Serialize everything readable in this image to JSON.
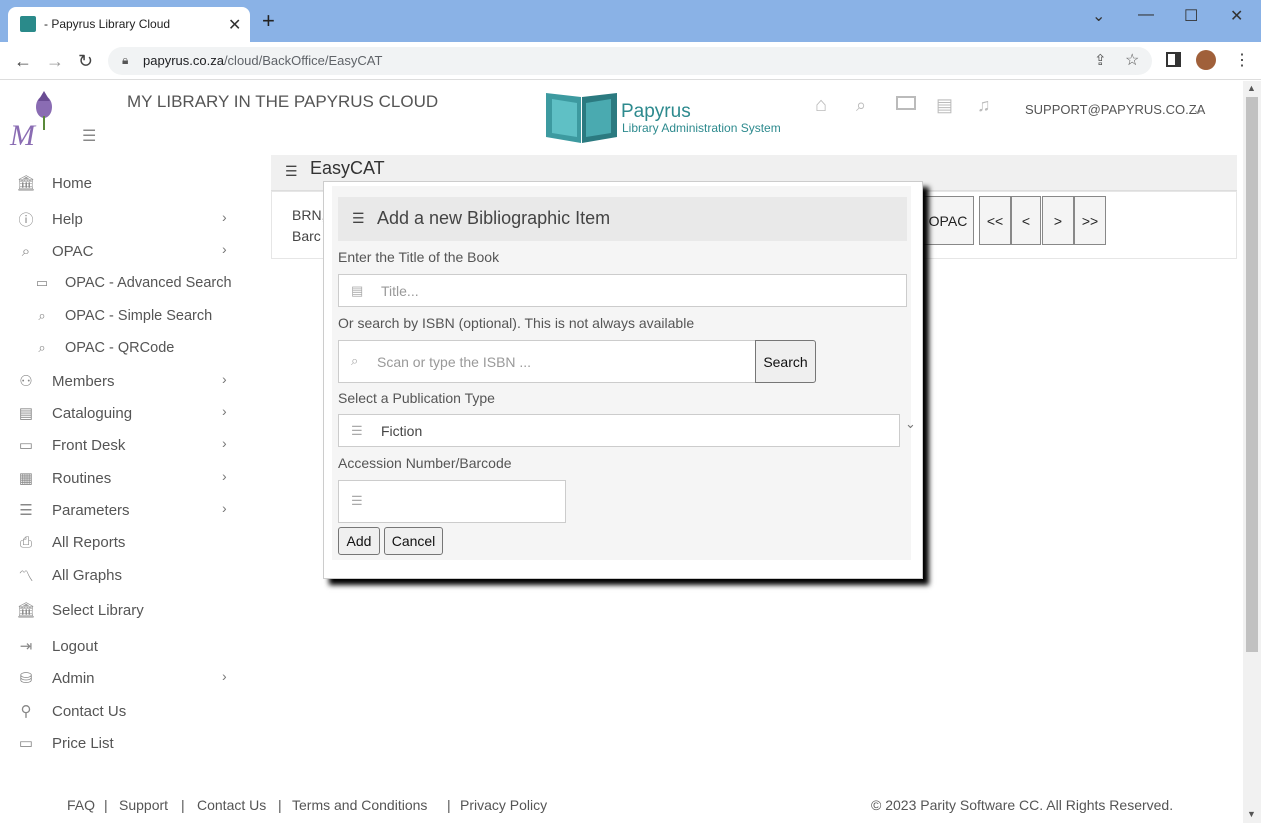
{
  "browser": {
    "tab_title": "- Papyrus Library Cloud",
    "url_host": "papyrus.co.za",
    "url_path": "/cloud/BackOffice/EasyCAT"
  },
  "header": {
    "site_title": "MY LIBRARY IN THE PAPYRUS CLOUD",
    "brand_name": "Papyrus",
    "brand_sub": "Library Administration System",
    "user": "SUPPORT@PAPYRUS.CO.ZA"
  },
  "sidebar": {
    "items": [
      {
        "label": "Home",
        "icon": "bank-icon"
      },
      {
        "label": "Help",
        "icon": "info-icon"
      },
      {
        "label": "OPAC",
        "icon": "search-icon"
      },
      {
        "label": "OPAC - Advanced Search",
        "icon": "monitor-icon"
      },
      {
        "label": "OPAC - Simple Search",
        "icon": "search-icon"
      },
      {
        "label": "OPAC - QRCode",
        "icon": "search-icon"
      },
      {
        "label": "Members",
        "icon": "users-icon"
      },
      {
        "label": "Cataloguing",
        "icon": "book-icon"
      },
      {
        "label": "Front Desk",
        "icon": "desk-icon"
      },
      {
        "label": "Routines",
        "icon": "calendar-icon"
      },
      {
        "label": "Parameters",
        "icon": "list-icon"
      },
      {
        "label": "All Reports",
        "icon": "printer-icon"
      },
      {
        "label": "All Graphs",
        "icon": "graph-icon"
      },
      {
        "label": "Select Library",
        "icon": "bank-icon"
      },
      {
        "label": "Logout",
        "icon": "logout-icon"
      },
      {
        "label": "Admin",
        "icon": "database-icon"
      },
      {
        "label": "Contact Us",
        "icon": "user-icon"
      },
      {
        "label": "Price List",
        "icon": "folder-icon"
      }
    ]
  },
  "easycat": {
    "title": "EasyCAT",
    "brn_label": "BRN,",
    "barcode_label": "Barc",
    "opac_btn": "OPAC",
    "first_btn": "<<",
    "prev_btn": "<",
    "next_btn": ">",
    "last_btn": ">>"
  },
  "modal": {
    "title": "Add a new Bibliographic Item",
    "title_label": "Enter the Title of the Book",
    "title_placeholder": "Title...",
    "isbn_label": "Or search by ISBN (optional). This is not always available",
    "isbn_placeholder": "Scan or type the ISBN ...",
    "search_btn": "Search",
    "pubtype_label": "Select a Publication Type",
    "pubtype_value": "Fiction",
    "accession_label": "Accession Number/Barcode",
    "accession_value": "",
    "add_btn": "Add",
    "cancel_btn": "Cancel"
  },
  "footer": {
    "links": [
      "FAQ",
      "Support",
      "Contact Us",
      "Terms and Conditions",
      "Privacy Policy"
    ],
    "copyright": "© 2023 Parity Software CC. All Rights Reserved."
  }
}
